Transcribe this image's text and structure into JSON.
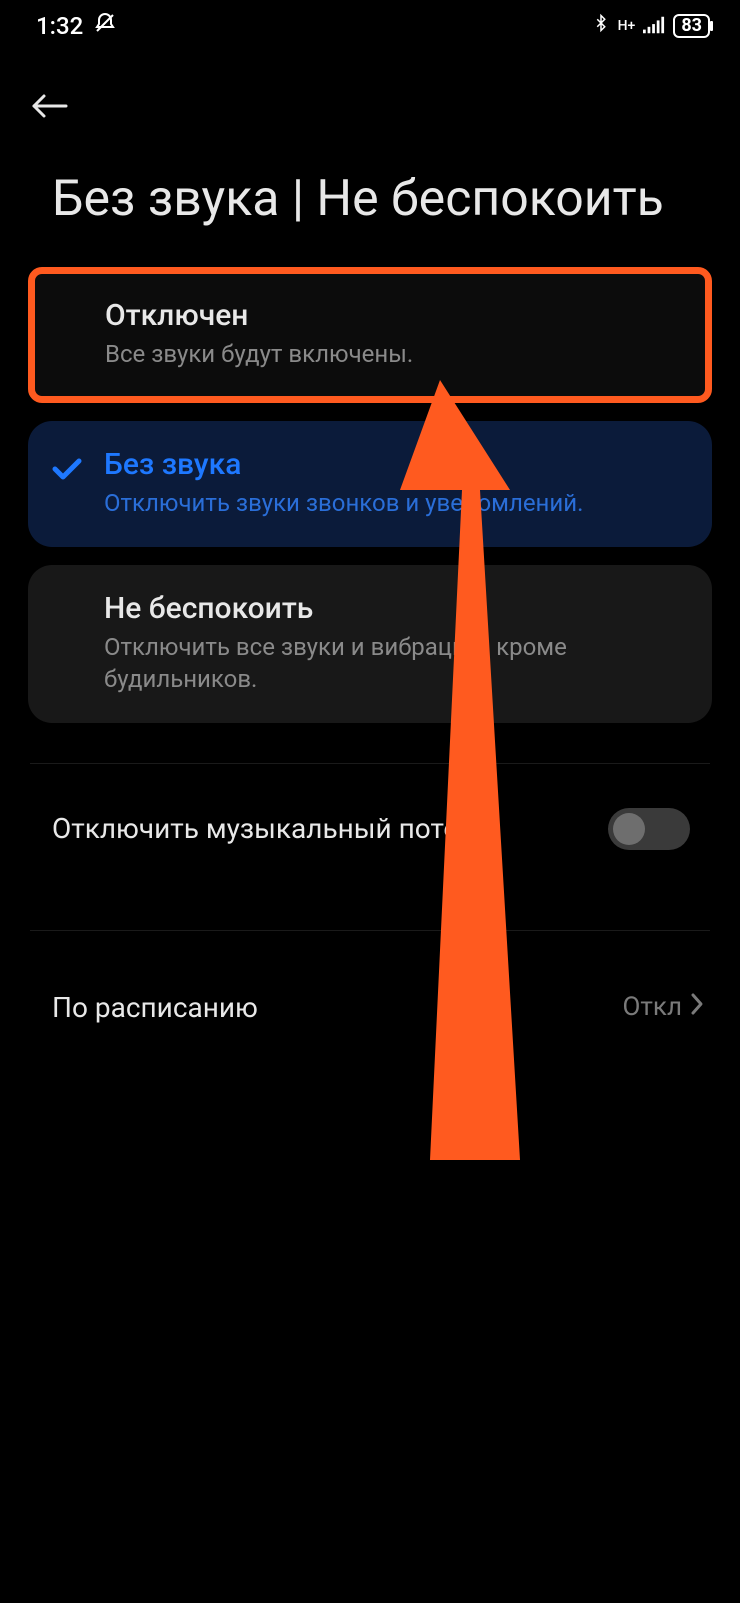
{
  "status": {
    "time": "1:32",
    "battery": "83",
    "network_label": "H+"
  },
  "page": {
    "title": "Без звука | Не беспокоить"
  },
  "options": [
    {
      "title": "Отключен",
      "subtitle": "Все звуки будут включены."
    },
    {
      "title": "Без звука",
      "subtitle": "Отключить звуки звонков и уведомлений."
    },
    {
      "title": "Не беспокоить",
      "subtitle": "Отключить все звуки и вибрацию, кроме будильников."
    }
  ],
  "toggle": {
    "label": "Отключить музыкальный поток",
    "on": false
  },
  "schedule": {
    "label": "По расписанию",
    "value": "Откл"
  },
  "icons": {
    "mute": "mute-icon",
    "bluetooth": "bluetooth-icon",
    "signal": "signal-icon",
    "back": "arrow-left-icon",
    "check": "check-icon",
    "chevron": "chevron-right-icon"
  }
}
